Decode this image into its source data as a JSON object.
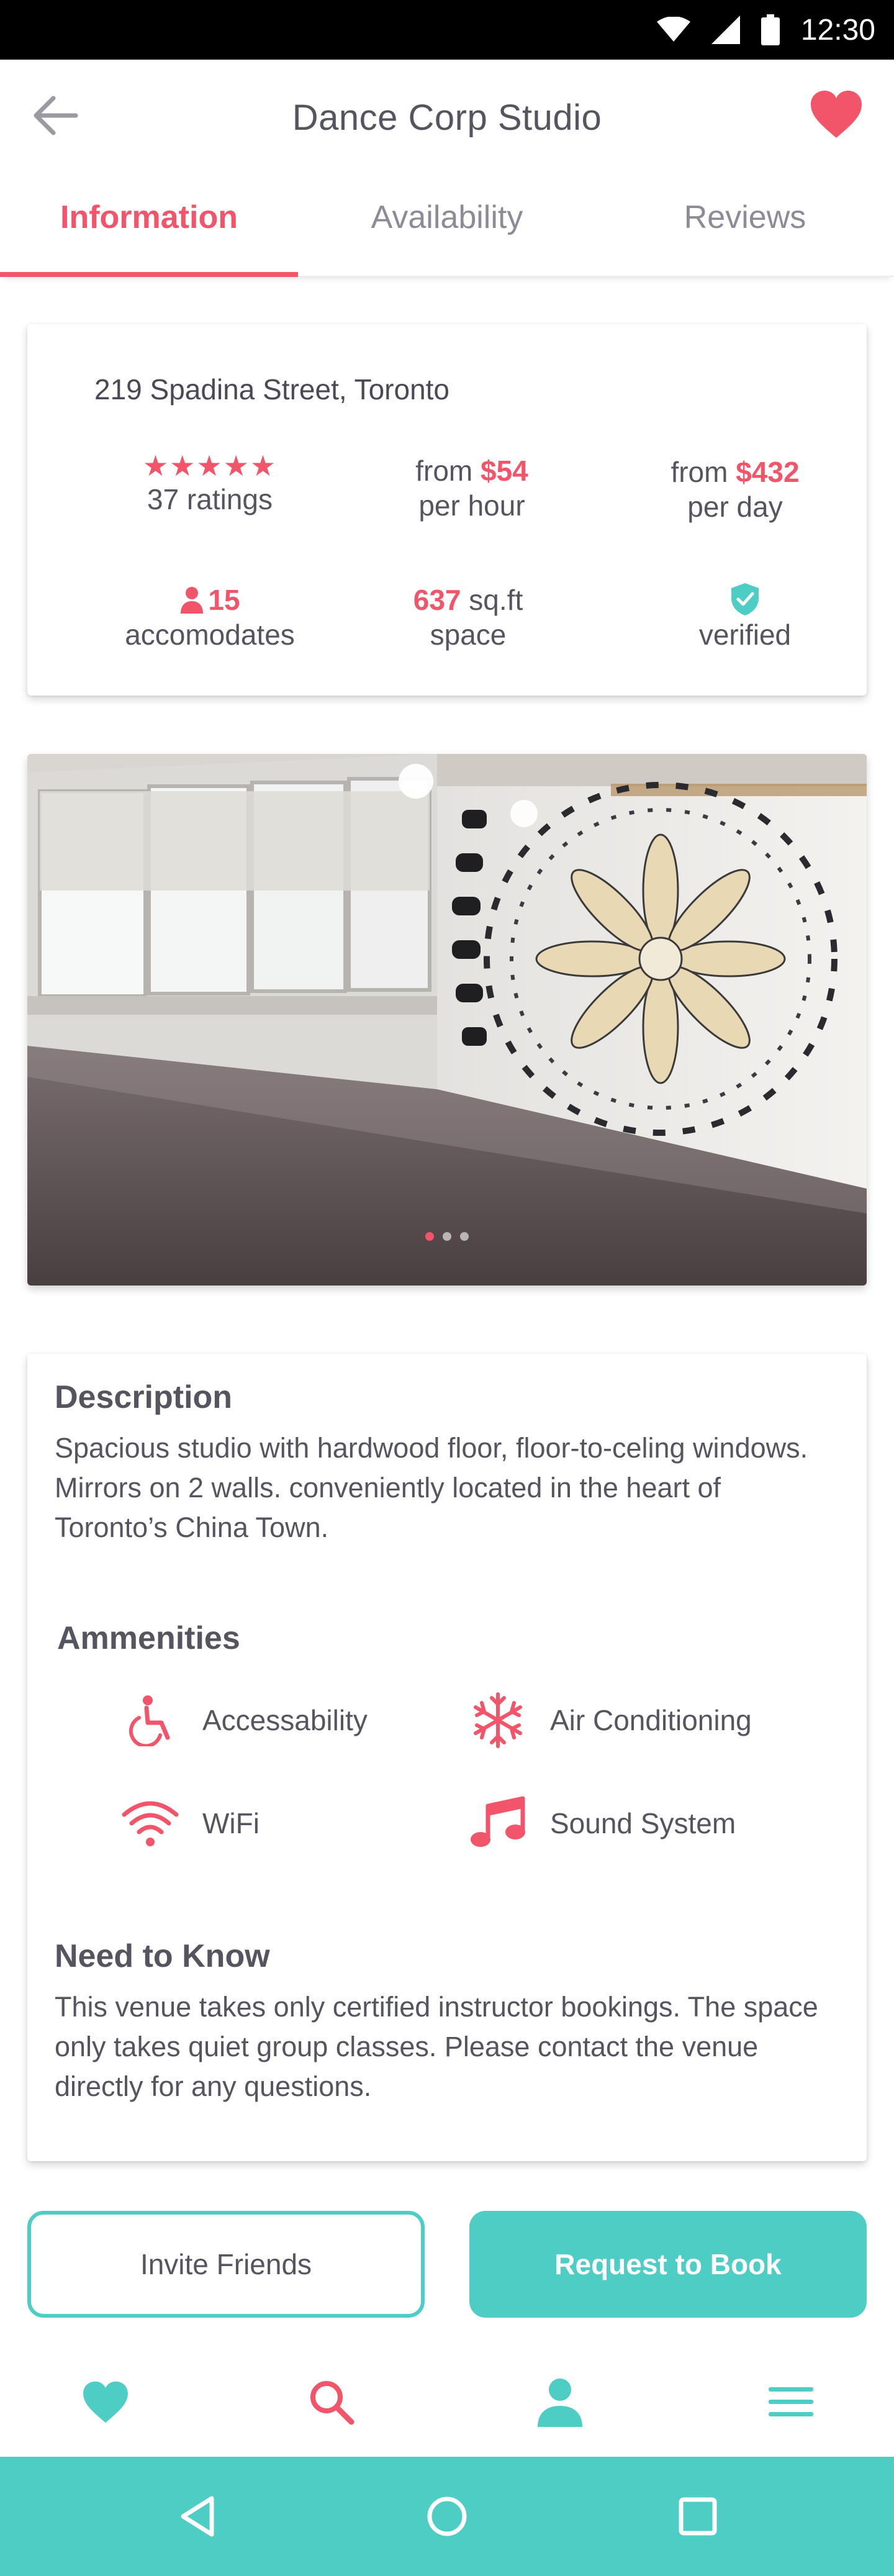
{
  "status_bar": {
    "time": "12:30",
    "icons": [
      "wifi-icon",
      "signal-icon",
      "battery-icon"
    ]
  },
  "header": {
    "title": "Dance Corp Studio",
    "back_icon": "arrow-left-icon",
    "favorite_icon": "heart-icon"
  },
  "tabs": [
    {
      "label": "Information",
      "active": true
    },
    {
      "label": "Availability",
      "active": false
    },
    {
      "label": "Reviews",
      "active": false
    }
  ],
  "info": {
    "address": "219 Spadina Street, Toronto",
    "rating": {
      "stars": "★★★★★",
      "label": "37 ratings"
    },
    "hourly": {
      "prefix": "from",
      "price": "$54",
      "unit": "per hour"
    },
    "daily": {
      "prefix": "from",
      "price": "$432",
      "unit": "per day"
    },
    "capacity": {
      "value": "15",
      "label": "accomodates",
      "icon": "person-icon"
    },
    "size": {
      "value": "637",
      "unit": "sq.ft",
      "label": "space"
    },
    "verified": {
      "label": "verified",
      "icon": "shield-check-icon"
    }
  },
  "gallery": {
    "slide_count": 3,
    "active_index": 0
  },
  "description": {
    "title": "Description",
    "text": "Spacious studio with hardwood floor, floor-to-celing windows. Mirrors on 2 walls. conveniently located in the heart of Toronto’s China Town."
  },
  "amenities": {
    "title": "Ammenities",
    "items": [
      {
        "label": "Accessability",
        "icon": "wheelchair-icon"
      },
      {
        "label": "Air Conditioning",
        "icon": "snowflake-icon"
      },
      {
        "label": "WiFi",
        "icon": "wifi-icon"
      },
      {
        "label": "Sound System",
        "icon": "music-note-icon"
      }
    ]
  },
  "need_to_know": {
    "title": "Need to Know",
    "text": "This venue takes only certified instructor bookings. The space only takes quiet group classes. Please contact the venue directly for any questions."
  },
  "actions": {
    "invite_label": "Invite Friends",
    "book_label": "Request to Book"
  },
  "bottom_nav": [
    "heart-icon",
    "search-icon",
    "profile-icon",
    "menu-icon"
  ],
  "system_nav": [
    "back-triangle-icon",
    "home-circle-icon",
    "recents-square-icon"
  ],
  "colors": {
    "accent": "#f2546a",
    "teal": "#4ecdc4",
    "text": "#55555f"
  }
}
